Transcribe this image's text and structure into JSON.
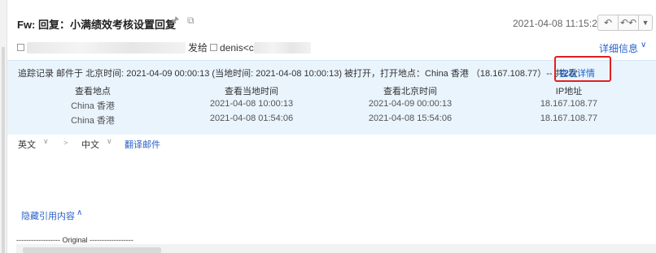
{
  "header": {
    "subject": "Fw: 回复：小满绩效考核设置回复",
    "date": "2021-04-08 11:15:26",
    "from_connector": "发给",
    "to_prefix": "denis<c",
    "detail_link": "详细信息"
  },
  "tracking": {
    "summary": "追踪记录 邮件于 北京时间: 2021-04-09 00:00:13 (当地时间: 2021-04-08 10:00:13) 被打开，打开地点：China 香港 （18.167.108.77）-- 共2次",
    "view_detail": "查看详情",
    "columns": [
      "查看地点",
      "查看当地时间",
      "查看北京时间",
      "IP地址"
    ],
    "rows": [
      [
        "China 香港",
        "2021-04-08 10:00:13",
        "2021-04-09 00:00:13",
        "18.167.108.77"
      ],
      [
        "China 香港",
        "2021-04-08 01:54:06",
        "2021-04-08 15:54:06",
        "18.167.108.77"
      ]
    ]
  },
  "translate": {
    "source_lang": "英文",
    "arrow": ">",
    "target_lang": "中文",
    "translate_link": "翻译邮件"
  },
  "body": {
    "hide_quote": "隐藏引用内容",
    "original_separator": "------------------ Original ------------------"
  },
  "colors": {
    "link": "#2a62c9",
    "track_bg": "#eaf4fd",
    "highlight": "#e02020"
  }
}
